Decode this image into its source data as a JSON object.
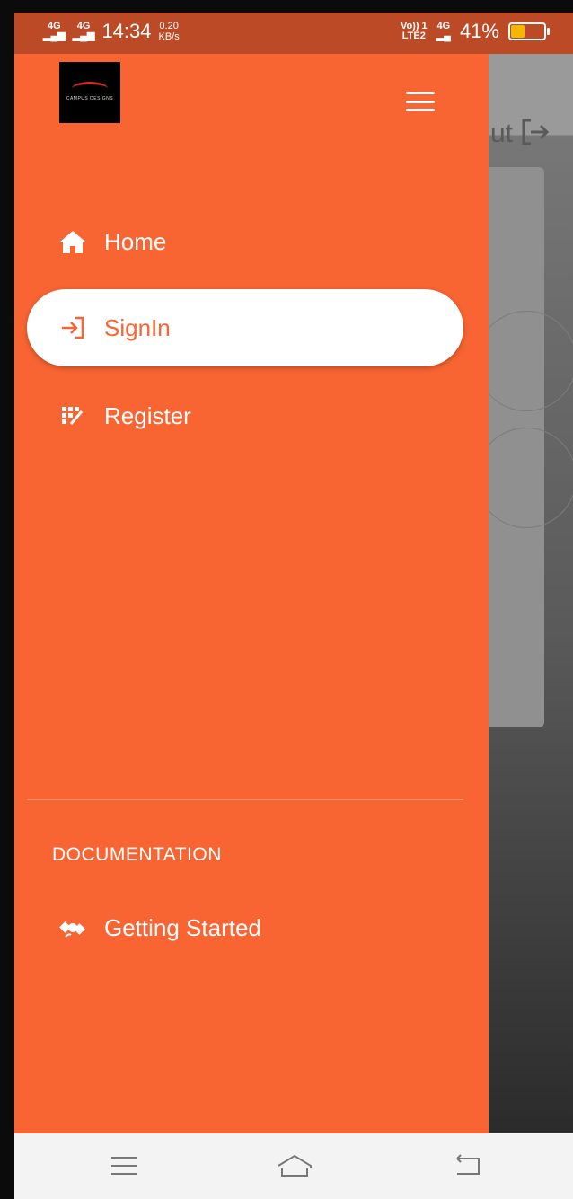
{
  "status_bar": {
    "network1": "4G",
    "network2": "4G",
    "time": "14:34",
    "speed_value": "0.20",
    "speed_unit": "KB/s",
    "volte": "Vo)) 1",
    "lte": "LTE2",
    "network3": "4G",
    "battery": "41%",
    "battery_level": 0.41
  },
  "background": {
    "logout_text": "ut"
  },
  "drawer": {
    "logo_text": "CAMPUS DESIGNS",
    "nav_items": [
      {
        "label": "Home",
        "icon": "home-icon"
      },
      {
        "label": "SignIn",
        "icon": "sign-in-icon"
      },
      {
        "label": "Register",
        "icon": "register-icon"
      }
    ],
    "section_title": "DOCUMENTATION",
    "doc_items": [
      {
        "label": "Getting Started",
        "icon": "satellite-icon"
      }
    ]
  },
  "colors": {
    "drawer_bg": "#f86432",
    "status_bar_bg": "#bd4a26",
    "active_bg": "#ffffff",
    "nav_bg": "#f3f3f3"
  },
  "android_nav": {
    "menu_icon": "menu-icon",
    "home_icon": "home-outline-icon",
    "back_icon": "back-icon"
  }
}
